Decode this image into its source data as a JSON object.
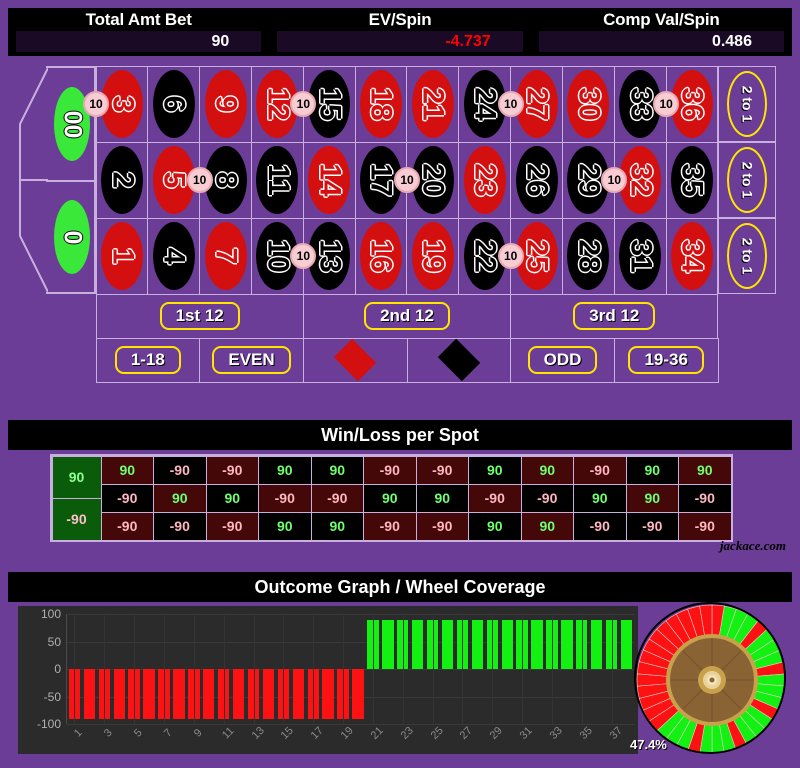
{
  "header": {
    "stats": [
      {
        "label": "Total Amt Bet",
        "value": "90",
        "negative": false
      },
      {
        "label": "EV/Spin",
        "value": "-4.737",
        "negative": true
      },
      {
        "label": "Comp Val/Spin",
        "value": "0.486",
        "negative": false
      }
    ]
  },
  "table": {
    "zeros": [
      {
        "label": "00",
        "name": "double-zero"
      },
      {
        "label": "0",
        "name": "single-zero"
      }
    ],
    "rows": [
      [
        {
          "n": "3",
          "color": "red"
        },
        {
          "n": "6",
          "color": "black"
        },
        {
          "n": "9",
          "color": "red"
        },
        {
          "n": "12",
          "color": "red"
        },
        {
          "n": "15",
          "color": "black"
        },
        {
          "n": "18",
          "color": "red"
        },
        {
          "n": "21",
          "color": "red"
        },
        {
          "n": "24",
          "color": "black"
        },
        {
          "n": "27",
          "color": "red"
        },
        {
          "n": "30",
          "color": "red"
        },
        {
          "n": "33",
          "color": "black"
        },
        {
          "n": "36",
          "color": "red"
        }
      ],
      [
        {
          "n": "2",
          "color": "black"
        },
        {
          "n": "5",
          "color": "red"
        },
        {
          "n": "8",
          "color": "black"
        },
        {
          "n": "11",
          "color": "black"
        },
        {
          "n": "14",
          "color": "red"
        },
        {
          "n": "17",
          "color": "black"
        },
        {
          "n": "20",
          "color": "black"
        },
        {
          "n": "23",
          "color": "red"
        },
        {
          "n": "26",
          "color": "black"
        },
        {
          "n": "29",
          "color": "black"
        },
        {
          "n": "32",
          "color": "red"
        },
        {
          "n": "35",
          "color": "black"
        }
      ],
      [
        {
          "n": "1",
          "color": "red"
        },
        {
          "n": "4",
          "color": "black"
        },
        {
          "n": "7",
          "color": "red"
        },
        {
          "n": "10",
          "color": "black"
        },
        {
          "n": "13",
          "color": "black"
        },
        {
          "n": "16",
          "color": "red"
        },
        {
          "n": "19",
          "color": "red"
        },
        {
          "n": "22",
          "color": "black"
        },
        {
          "n": "25",
          "color": "red"
        },
        {
          "n": "28",
          "color": "black"
        },
        {
          "n": "31",
          "color": "black"
        },
        {
          "n": "34",
          "color": "red"
        }
      ]
    ],
    "column_bets": [
      {
        "label": "2 to 1"
      },
      {
        "label": "2 to 1"
      },
      {
        "label": "2 to 1"
      }
    ],
    "dozens": [
      {
        "label": "1st 12"
      },
      {
        "label": "2nd 12"
      },
      {
        "label": "3rd 12"
      }
    ],
    "even_money": [
      {
        "label": "1-18",
        "kind": "text"
      },
      {
        "label": "EVEN",
        "kind": "text"
      },
      {
        "label": "",
        "kind": "diamond-red"
      },
      {
        "label": "",
        "kind": "diamond-black"
      },
      {
        "label": "ODD",
        "kind": "text"
      },
      {
        "label": "19-36",
        "kind": "text"
      }
    ],
    "chips": [
      {
        "amount": "10",
        "row": 0,
        "boundary": 0,
        "bet": "00-3 split"
      },
      {
        "amount": "10",
        "row": 0,
        "boundary": 4,
        "bet": "12-15 split"
      },
      {
        "amount": "10",
        "row": 0,
        "boundary": 8,
        "bet": "24-27 split"
      },
      {
        "amount": "10",
        "row": 0,
        "boundary": 11,
        "bet": "33-36 split"
      },
      {
        "amount": "10",
        "row": 1,
        "boundary": 2,
        "bet": "5-8 split"
      },
      {
        "amount": "10",
        "row": 1,
        "boundary": 6,
        "bet": "17-20 split"
      },
      {
        "amount": "10",
        "row": 1,
        "boundary": 10,
        "bet": "29-32 split"
      },
      {
        "amount": "10",
        "row": 2,
        "boundary": 4,
        "bet": "10-13 split"
      },
      {
        "amount": "10",
        "row": 2,
        "boundary": 8,
        "bet": "22-25 split"
      }
    ]
  },
  "winloss": {
    "title": "Win/Loss per Spot",
    "watermark": "jackace.com",
    "zero_cells": [
      {
        "value": "90",
        "win": true
      },
      {
        "value": "-90",
        "win": false
      }
    ],
    "columns": [
      [
        {
          "value": "90",
          "win": true,
          "dark": true
        },
        {
          "value": "-90",
          "win": false,
          "dark": false
        },
        {
          "value": "-90",
          "win": false,
          "dark": true
        }
      ],
      [
        {
          "value": "-90",
          "win": false,
          "dark": false
        },
        {
          "value": "90",
          "win": true,
          "dark": true
        },
        {
          "value": "-90",
          "win": false,
          "dark": false
        }
      ],
      [
        {
          "value": "-90",
          "win": false,
          "dark": true
        },
        {
          "value": "90",
          "win": true,
          "dark": false
        },
        {
          "value": "-90",
          "win": false,
          "dark": true
        }
      ],
      [
        {
          "value": "90",
          "win": true,
          "dark": false
        },
        {
          "value": "-90",
          "win": false,
          "dark": true
        },
        {
          "value": "90",
          "win": true,
          "dark": false
        }
      ],
      [
        {
          "value": "90",
          "win": true,
          "dark": false
        },
        {
          "value": "-90",
          "win": false,
          "dark": true
        },
        {
          "value": "90",
          "win": true,
          "dark": false
        }
      ],
      [
        {
          "value": "-90",
          "win": false,
          "dark": true
        },
        {
          "value": "90",
          "win": true,
          "dark": false
        },
        {
          "value": "-90",
          "win": false,
          "dark": true
        }
      ],
      [
        {
          "value": "-90",
          "win": false,
          "dark": true
        },
        {
          "value": "90",
          "win": true,
          "dark": false
        },
        {
          "value": "-90",
          "win": false,
          "dark": true
        }
      ],
      [
        {
          "value": "90",
          "win": true,
          "dark": false
        },
        {
          "value": "-90",
          "win": false,
          "dark": true
        },
        {
          "value": "90",
          "win": true,
          "dark": false
        }
      ],
      [
        {
          "value": "90",
          "win": true,
          "dark": true
        },
        {
          "value": "-90",
          "win": false,
          "dark": false
        },
        {
          "value": "90",
          "win": true,
          "dark": true
        }
      ],
      [
        {
          "value": "-90",
          "win": false,
          "dark": true
        },
        {
          "value": "90",
          "win": true,
          "dark": false
        },
        {
          "value": "-90",
          "win": false,
          "dark": false
        }
      ],
      [
        {
          "value": "90",
          "win": true,
          "dark": false
        },
        {
          "value": "90",
          "win": true,
          "dark": true
        },
        {
          "value": "-90",
          "win": false,
          "dark": false
        }
      ],
      [
        {
          "value": "90",
          "win": true,
          "dark": true
        },
        {
          "value": "-90",
          "win": false,
          "dark": false
        },
        {
          "value": "-90",
          "win": false,
          "dark": true
        }
      ]
    ]
  },
  "outcome": {
    "title": "Outcome Graph / Wheel Coverage",
    "coverage": "47.4%"
  },
  "chart_data": {
    "type": "bar",
    "title": "Outcome Graph / Wheel Coverage",
    "xlabel": "",
    "ylabel": "",
    "ylim": [
      -100,
      100
    ],
    "yticks": [
      100,
      50,
      0,
      -50,
      -100
    ],
    "grid": true,
    "legend": null,
    "categories": [
      "1",
      "2",
      "3",
      "4",
      "5",
      "6",
      "7",
      "8",
      "9",
      "10",
      "11",
      "12",
      "13",
      "14",
      "15",
      "16",
      "17",
      "18",
      "19",
      "20",
      "21",
      "22",
      "23",
      "24",
      "25",
      "26",
      "27",
      "28",
      "29",
      "30",
      "31",
      "32",
      "33",
      "34",
      "35",
      "36",
      "37",
      "38"
    ],
    "xtick_labels": [
      "1",
      "3",
      "5",
      "7",
      "9",
      "11",
      "13",
      "15",
      "17",
      "19",
      "21",
      "23",
      "25",
      "27",
      "29",
      "31",
      "33",
      "35",
      "37"
    ],
    "values": [
      -90,
      -90,
      -90,
      -90,
      -90,
      -90,
      -90,
      -90,
      -90,
      -90,
      -90,
      -90,
      -90,
      -90,
      -90,
      -90,
      -90,
      -90,
      -90,
      -90,
      90,
      90,
      90,
      90,
      90,
      90,
      90,
      90,
      90,
      90,
      90,
      90,
      90,
      90,
      90,
      90,
      90,
      90
    ],
    "colors": [
      "#fc1212",
      "#12f112"
    ],
    "annotations": [
      {
        "text": "47.4%",
        "meaning": "wheel coverage"
      }
    ]
  }
}
